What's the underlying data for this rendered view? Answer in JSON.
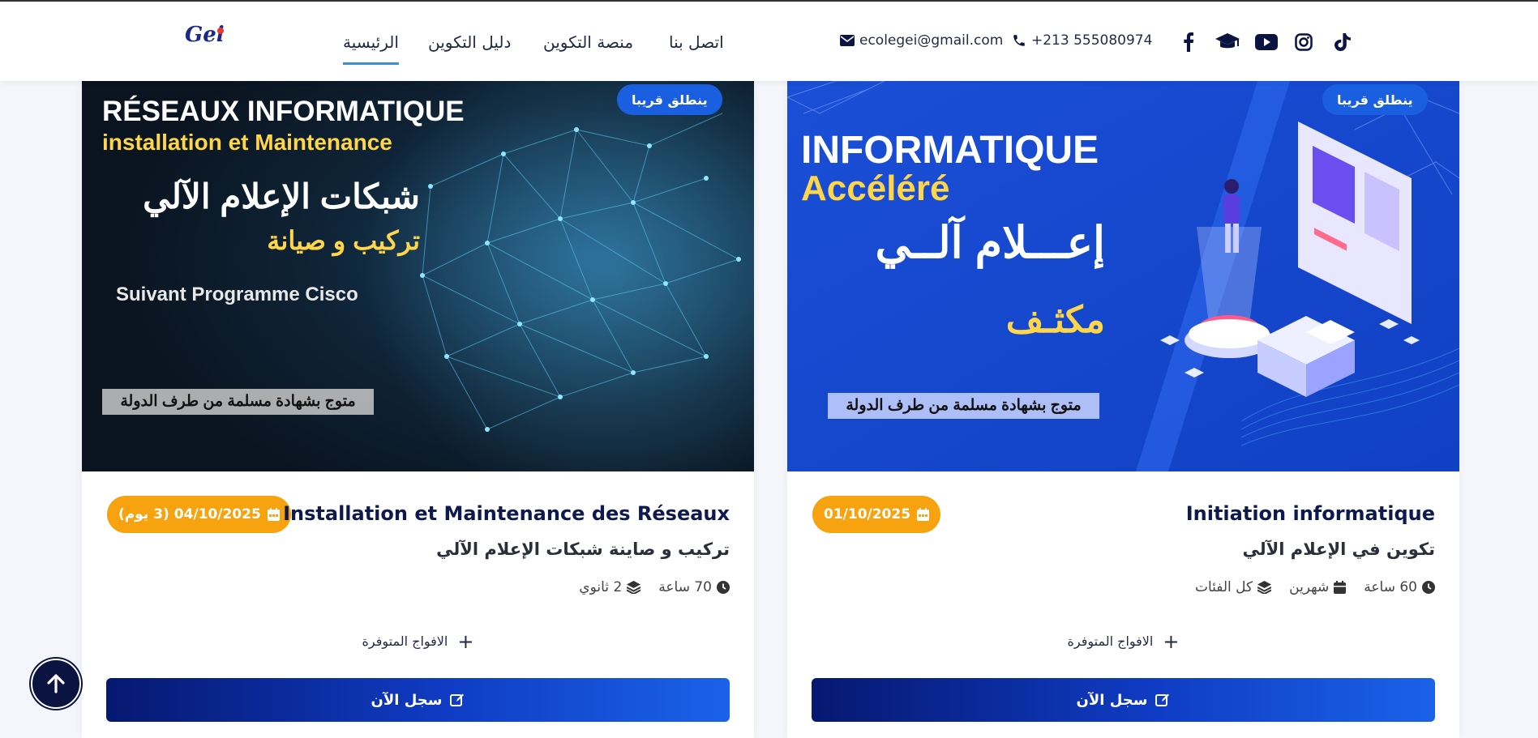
{
  "logo": {
    "text": "Gei"
  },
  "nav": {
    "home": "الرئيسية",
    "guide": "دليل التكوين",
    "platform": "منصة التكوين",
    "contact": "اتصل بنا"
  },
  "contact": {
    "email": "ecolegei@gmail.com",
    "phone": "+213 555080974"
  },
  "social_icons": [
    "facebook-icon",
    "graduation-cap-icon",
    "youtube-icon",
    "instagram-icon",
    "tiktok-icon"
  ],
  "colors": {
    "accent_blue": "#1a5fe0",
    "date_orange": "#f7a20f",
    "navy": "#0b1440",
    "active_underline": "#3a8fd6"
  },
  "cards": [
    {
      "badge": "ينطلق قريبا",
      "image": {
        "line1": "RÉSEAUX INFORMATIQUE",
        "line2": "installation et Maintenance",
        "line3": "شبكات الإعلام الآلي",
        "line4": "تركيب و صيانة",
        "line5": "Suivant Programme Cisco",
        "line6": "متوج بشهادة مسلمة من طرف الدولة"
      },
      "date": "04/10/2025 (3 يوم)",
      "title": "Installation et Maintenance des Réseaux",
      "subtitle": "تركيب و صاينة شبكات الإعلام الآلي",
      "hours": "70 ساعة",
      "level": "2 ثانوي",
      "groups": "الافواج المتوفرة",
      "register": "سجل الآن"
    },
    {
      "badge": "ينطلق قريبا",
      "image": {
        "line1": "INFORMATIQUE",
        "line2": "Accéléré",
        "line3": "إعـــلام آلــي",
        "line4": "مكثـف",
        "line6": "متوج بشهادة مسلمة من طرف الدولة"
      },
      "date": "01/10/2025",
      "title": "Initiation informatique",
      "subtitle": "تكوين في الإعلام الآلي",
      "hours": "60 ساعة",
      "duration": "شهرين",
      "level": "كل الفئات",
      "groups": "الافواج المتوفرة",
      "register": "سجل الآن"
    }
  ]
}
